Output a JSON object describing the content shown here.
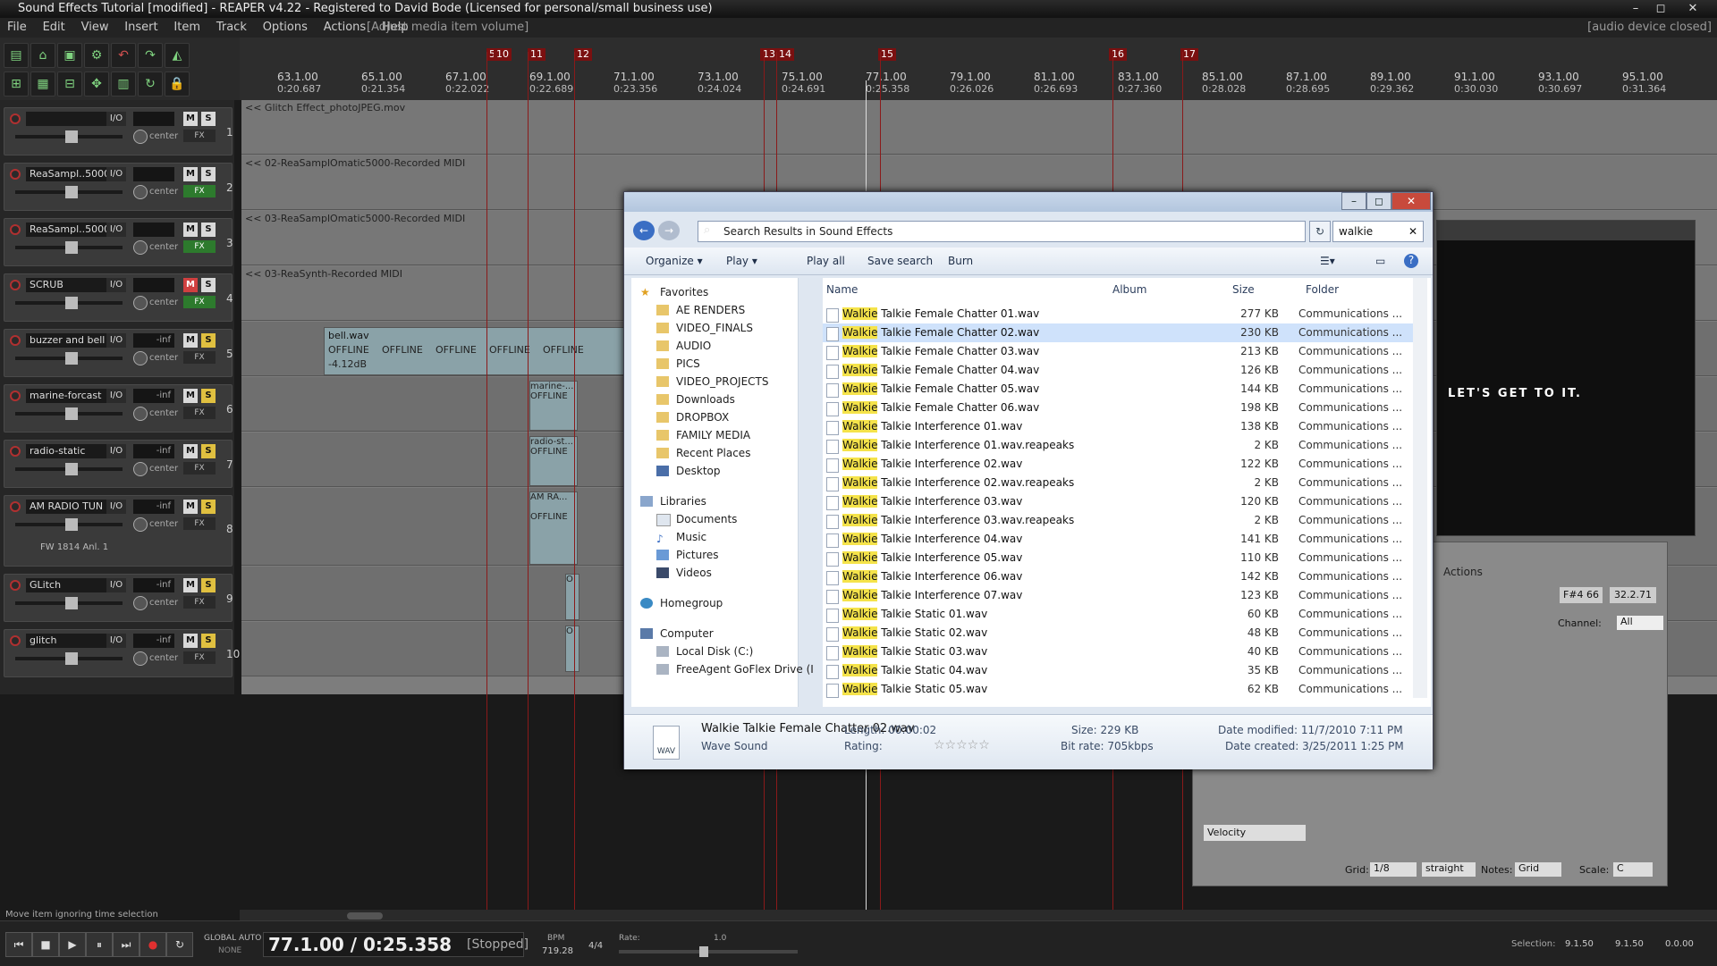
{
  "app": {
    "title": "Sound Effects Tutorial [modified] - REAPER v4.22 - Registered to David Bode (Licensed for personal/small business use)",
    "menus": [
      "File",
      "Edit",
      "View",
      "Insert",
      "Item",
      "Track",
      "Options",
      "Actions",
      "Help"
    ],
    "last_action": "[Adjust media item volume]",
    "device_status": "[audio device closed]"
  },
  "ruler": {
    "markers": [
      "5",
      "10",
      "11",
      "12",
      "13",
      "14",
      "15",
      "16",
      "17"
    ],
    "ticks": [
      {
        "bar": "63.1.00",
        "time": "0:20.687"
      },
      {
        "bar": "65.1.00",
        "time": "0:21.354"
      },
      {
        "bar": "67.1.00",
        "time": "0:22.022"
      },
      {
        "bar": "69.1.00",
        "time": "0:22.689"
      },
      {
        "bar": "71.1.00",
        "time": "0:23.356"
      },
      {
        "bar": "73.1.00",
        "time": "0:24.024"
      },
      {
        "bar": "75.1.00",
        "time": "0:24.691"
      },
      {
        "bar": "77.1.00",
        "time": "0:25.358"
      },
      {
        "bar": "79.1.00",
        "time": "0:26.026"
      },
      {
        "bar": "81.1.00",
        "time": "0:26.693"
      },
      {
        "bar": "83.1.00",
        "time": "0:27.360"
      },
      {
        "bar": "85.1.00",
        "time": "0:28.028"
      },
      {
        "bar": "87.1.00",
        "time": "0:28.695"
      },
      {
        "bar": "89.1.00",
        "time": "0:29.362"
      },
      {
        "bar": "91.1.00",
        "time": "0:30.030"
      },
      {
        "bar": "93.1.00",
        "time": "0:30.697"
      },
      {
        "bar": "95.1.00",
        "time": "0:31.364"
      }
    ]
  },
  "tracks": [
    {
      "num": "1",
      "name": "",
      "io": "I/O",
      "vu": "",
      "m": "M",
      "s": "S",
      "pan": "center",
      "fx": "FX",
      "fx_on": false,
      "lane_label": "<< Glitch Effect_photoJPEG.mov"
    },
    {
      "num": "2",
      "name": "ReaSampl..5000",
      "io": "I/O",
      "vu": "",
      "m": "M",
      "s": "S",
      "pan": "center",
      "fx": "FX",
      "fx_on": true,
      "lane_label": "<< 02-ReaSamplOmatic5000-Recorded MIDI"
    },
    {
      "num": "3",
      "name": "ReaSampl..5000",
      "io": "I/O",
      "vu": "",
      "m": "M",
      "s": "S",
      "pan": "center",
      "fx": "FX",
      "fx_on": true,
      "lane_label": "<< 03-ReaSamplOmatic5000-Recorded MIDI"
    },
    {
      "num": "4",
      "name": "SCRUB",
      "io": "I/O",
      "vu": "",
      "m": "M",
      "s": "S",
      "pan": "center",
      "fx": "FX",
      "fx_on": true,
      "m_on": true,
      "lane_label": "<< 03-ReaSynth-Recorded MIDI"
    },
    {
      "num": "5",
      "name": "buzzer and bell",
      "io": "I/O",
      "vu": "-inf",
      "m": "M",
      "s": "S",
      "pan": "center",
      "fx": "FX",
      "fx_on": false,
      "s_on": true,
      "lane_label": ""
    },
    {
      "num": "6",
      "name": "marine-forcast",
      "io": "I/O",
      "vu": "-inf",
      "m": "M",
      "s": "S",
      "pan": "center",
      "fx": "FX",
      "fx_on": false,
      "s_on": true,
      "lane_label": ""
    },
    {
      "num": "7",
      "name": "radio-static",
      "io": "I/O",
      "vu": "-inf",
      "m": "M",
      "s": "S",
      "pan": "center",
      "fx": "FX",
      "fx_on": false,
      "s_on": true,
      "lane_label": ""
    },
    {
      "num": "8",
      "name": "AM RADIO TUN",
      "io": "I/O",
      "vu": "-inf",
      "m": "M",
      "s": "S",
      "pan": "center",
      "fx": "FX",
      "fx_on": false,
      "s_on": true,
      "lane_label": "",
      "extra": "FW 1814 Anl. 1"
    },
    {
      "num": "9",
      "name": "GLitch",
      "io": "I/O",
      "vu": "-inf",
      "m": "M",
      "s": "S",
      "pan": "center",
      "fx": "FX",
      "fx_on": false,
      "s_on": true,
      "lane_label": ""
    },
    {
      "num": "10",
      "name": "glitch",
      "io": "I/O",
      "vu": "-inf",
      "m": "M",
      "s": "S",
      "pan": "center",
      "fx": "FX",
      "fx_on": false,
      "s_on": true,
      "lane_label": ""
    }
  ],
  "arrange_items": {
    "bell_label": "bell.wav",
    "bell_db": "-4.12dB",
    "offline": "OFFLINE",
    "marine": "marine-...",
    "radio": "radio-st...",
    "amra": "AM RA...",
    "oneliner": "O"
  },
  "dialog": {
    "address_crumb": "Search Results in Sound Effects",
    "search_value": "walkie",
    "commands": [
      "Organize ▾",
      "Play ▾",
      "Play all",
      "Save search",
      "Burn"
    ],
    "nav": {
      "favorites": "Favorites",
      "fav_items": [
        "AE RENDERS",
        "VIDEO_FINALS",
        "AUDIO",
        "PICS",
        "VIDEO_PROJECTS",
        "Downloads",
        "DROPBOX",
        "FAMILY MEDIA",
        "Recent Places",
        "Desktop"
      ],
      "libraries": "Libraries",
      "lib_items": [
        "Documents",
        "Music",
        "Pictures",
        "Videos"
      ],
      "homegroup": "Homegroup",
      "computer": "Computer",
      "comp_items": [
        "Local Disk (C:)",
        "FreeAgent GoFlex Drive (I"
      ]
    },
    "columns": [
      "Name",
      "Album",
      "Size",
      "Folder"
    ],
    "highlight": "Walkie",
    "files": [
      {
        "rest": " Talkie Female Chatter 01.wav",
        "size": "277 KB",
        "folder": "Communications ..."
      },
      {
        "rest": " Talkie Female Chatter 02.wav",
        "size": "230 KB",
        "folder": "Communications ...",
        "selected": true
      },
      {
        "rest": " Talkie Female Chatter 03.wav",
        "size": "213 KB",
        "folder": "Communications ..."
      },
      {
        "rest": " Talkie Female Chatter 04.wav",
        "size": "126 KB",
        "folder": "Communications ..."
      },
      {
        "rest": " Talkie Female Chatter 05.wav",
        "size": "144 KB",
        "folder": "Communications ..."
      },
      {
        "rest": " Talkie Female Chatter 06.wav",
        "size": "198 KB",
        "folder": "Communications ..."
      },
      {
        "rest": " Talkie Interference 01.wav",
        "size": "138 KB",
        "folder": "Communications ..."
      },
      {
        "rest": " Talkie Interference 01.wav.reapeaks",
        "size": "2 KB",
        "folder": "Communications ..."
      },
      {
        "rest": " Talkie Interference 02.wav",
        "size": "122 KB",
        "folder": "Communications ..."
      },
      {
        "rest": " Talkie Interference 02.wav.reapeaks",
        "size": "2 KB",
        "folder": "Communications ..."
      },
      {
        "rest": " Talkie Interference 03.wav",
        "size": "120 KB",
        "folder": "Communications ..."
      },
      {
        "rest": " Talkie Interference 03.wav.reapeaks",
        "size": "2 KB",
        "folder": "Communications ..."
      },
      {
        "rest": " Talkie Interference 04.wav",
        "size": "141 KB",
        "folder": "Communications ..."
      },
      {
        "rest": " Talkie Interference 05.wav",
        "size": "110 KB",
        "folder": "Communications ..."
      },
      {
        "rest": " Talkie Interference 06.wav",
        "size": "142 KB",
        "folder": "Communications ..."
      },
      {
        "rest": " Talkie Interference 07.wav",
        "size": "123 KB",
        "folder": "Communications ..."
      },
      {
        "rest": " Talkie Static 01.wav",
        "size": "60 KB",
        "folder": "Communications ..."
      },
      {
        "rest": " Talkie Static 02.wav",
        "size": "48 KB",
        "folder": "Communications ..."
      },
      {
        "rest": " Talkie Static 03.wav",
        "size": "40 KB",
        "folder": "Communications ..."
      },
      {
        "rest": " Talkie Static 04.wav",
        "size": "35 KB",
        "folder": "Communications ..."
      },
      {
        "rest": " Talkie Static 05.wav",
        "size": "62 KB",
        "folder": "Communications ..."
      }
    ],
    "details": {
      "filename": "Walkie Talkie Female Chatter 02.wav",
      "type": "Wave Sound",
      "length": "Length: 00:00:02",
      "rating": "Rating:",
      "size": "Size: 229 KB",
      "bitrate": "Bit rate: 705kbps",
      "modified": "Date modified: 11/7/2010 7:11 PM",
      "created": "Date created: 3/25/2011 1:25 PM",
      "icon_label": "WAV"
    }
  },
  "video_panel": {
    "caption": "LET'S GET TO IT."
  },
  "midi": {
    "actions": "Actions",
    "note": "F#4  66",
    "pos": "32.2.71",
    "channel_label": "Channel:",
    "channel": "All",
    "velocity": "Velocity",
    "grid_label": "Grid:",
    "grid": "1/8",
    "swing": "straight",
    "notes_label": "Notes:",
    "notes": "Grid",
    "scale_label": "Scale:",
    "scale": "C"
  },
  "status": "Move item ignoring time selection",
  "transport": {
    "global_auto": "GLOBAL AUTO",
    "none": "NONE",
    "position": "77.1.00 / 0:25.358",
    "state": "[Stopped]",
    "bpm_label": "BPM",
    "bpm": "719.28",
    "sig": "4/4",
    "rate_label": "Rate:",
    "rate": "1.0",
    "selection_label": "Selection:",
    "sel_start": "9.1.50",
    "sel_end": "9.1.50",
    "sel_len": "0.0.00"
  }
}
